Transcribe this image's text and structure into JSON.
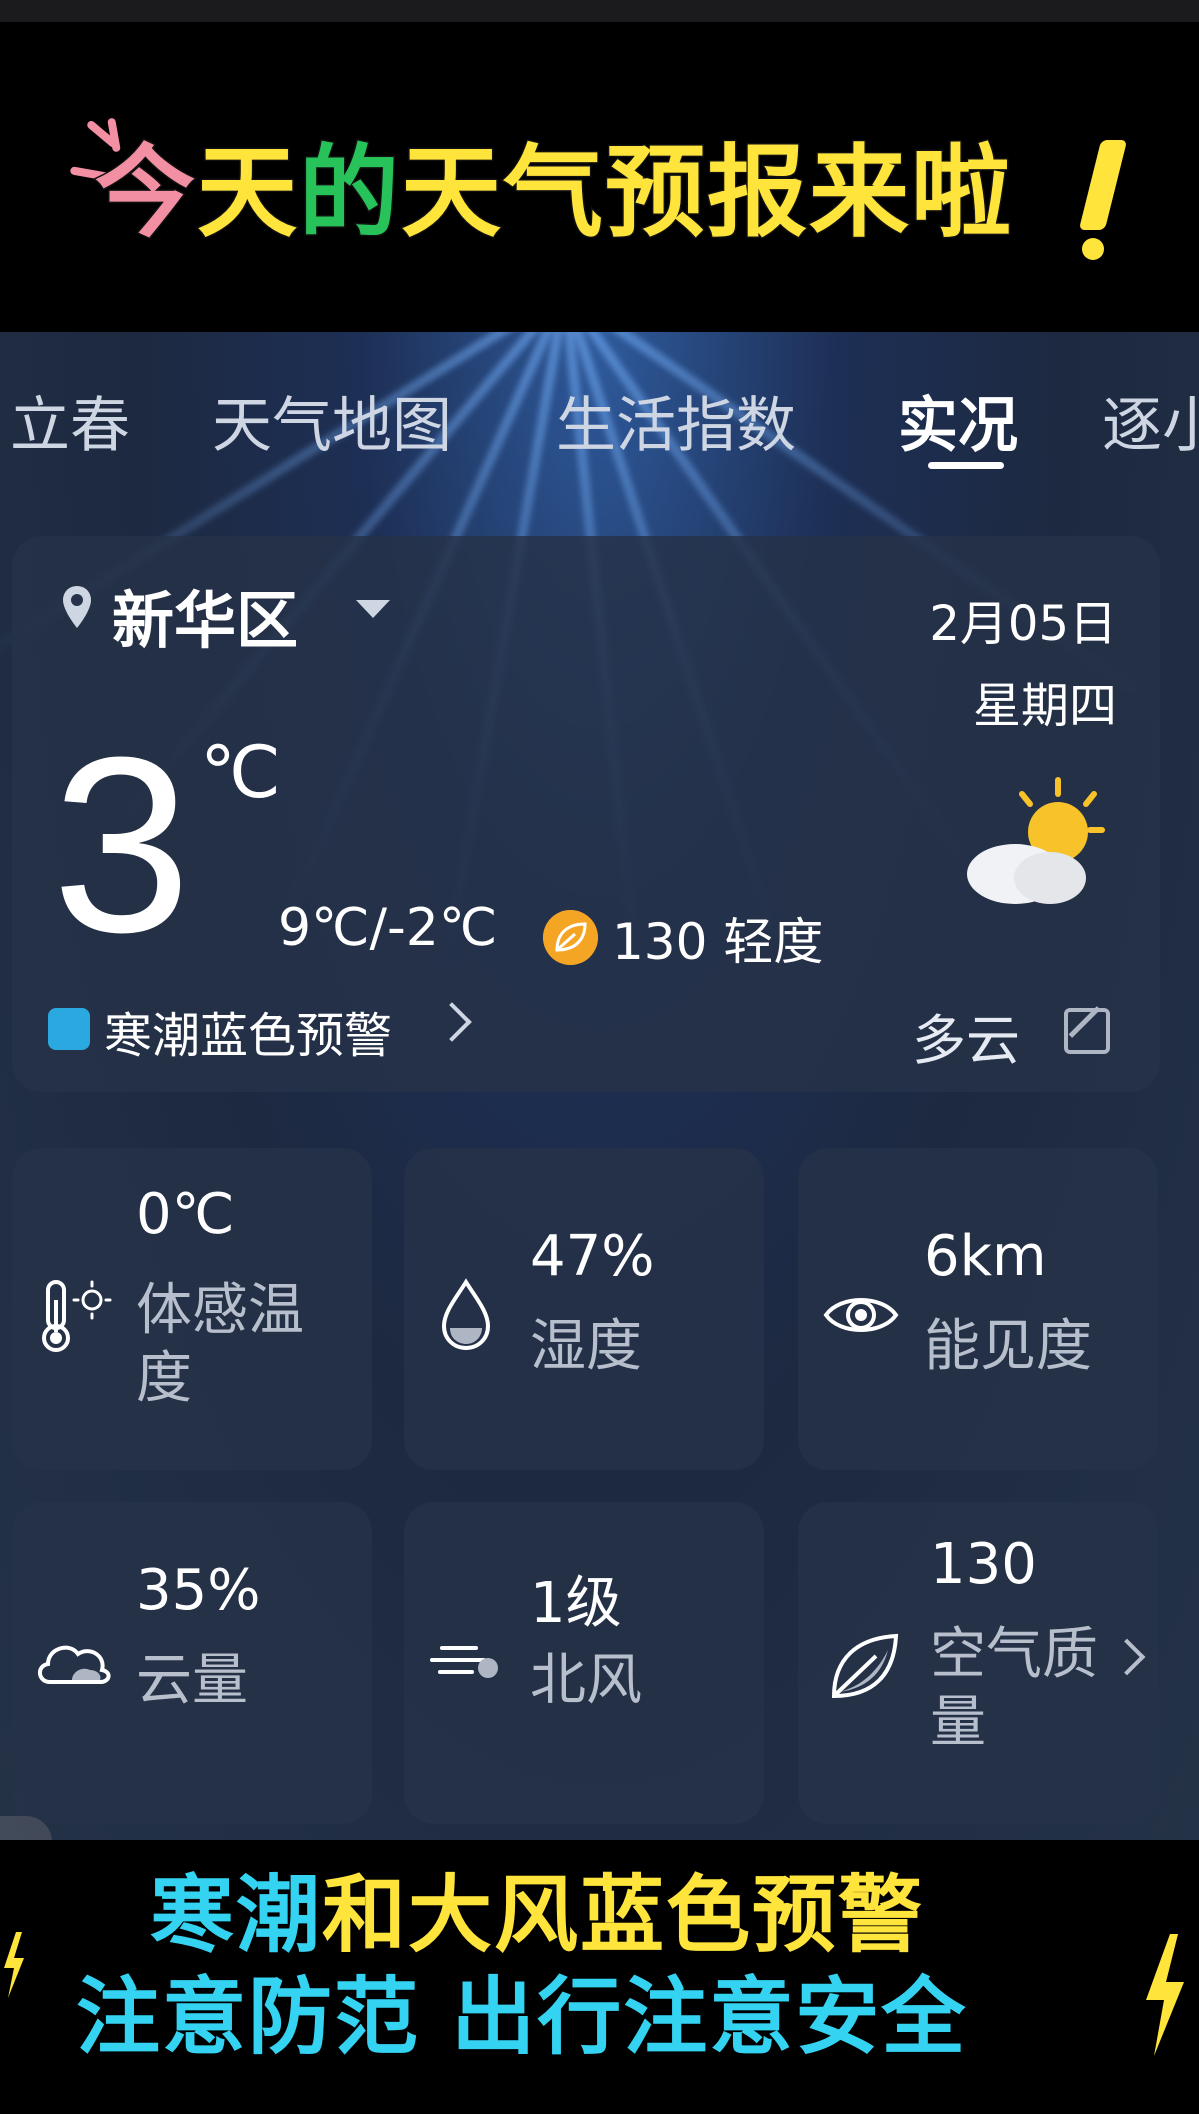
{
  "banner_top": {
    "title_parts": [
      "今",
      "天",
      "的",
      "天气预报来啦"
    ]
  },
  "tabs": [
    {
      "label": "立春"
    },
    {
      "label": "天气地图"
    },
    {
      "label": "生活指数"
    },
    {
      "label": "实况",
      "active": true
    },
    {
      "label": "逐小"
    }
  ],
  "current": {
    "location": "新华区",
    "date": "2月05日",
    "weekday": "星期四",
    "temperature": "3",
    "unit": "℃",
    "range": "9℃/-2℃",
    "aqi": "130 轻度",
    "warning": "寒潮蓝色预警",
    "condition": "多云",
    "condition_icon": "partly-cloudy-icon"
  },
  "tiles": [
    {
      "icon": "thermometer-sun-icon",
      "value": "0℃",
      "label_line1": "体感温",
      "label_line2": "度"
    },
    {
      "icon": "water-drop-icon",
      "value": "47%",
      "label_line1": "湿度",
      "label_line2": ""
    },
    {
      "icon": "eye-icon",
      "value": "6km",
      "label_line1": "能见度",
      "label_line2": ""
    },
    {
      "icon": "cloud-icon",
      "value": "35%",
      "label_line1": "云量",
      "label_line2": ""
    },
    {
      "icon": "wind-icon",
      "value": "1级",
      "label_line1": "北风",
      "label_line2": ""
    },
    {
      "icon": "leaf-icon",
      "value": "130",
      "label_line1": "空气质",
      "label_line2": "量"
    }
  ],
  "banner_bottom": {
    "line1_a": "寒潮",
    "line1_b": "和大风蓝色预警",
    "line2": "注意防范  出行注意安全"
  },
  "colors": {
    "accent_yellow": "#ffe43b",
    "accent_pink": "#f28fa3",
    "accent_green": "#27c35a",
    "caption_cyan": "#35d3f2",
    "aqi_orange": "#f5a524"
  }
}
